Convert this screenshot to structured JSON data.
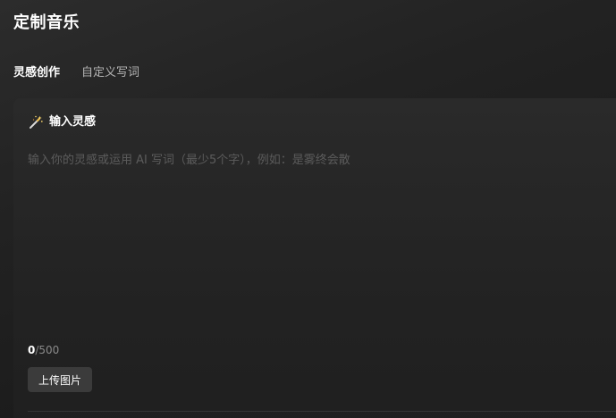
{
  "page": {
    "title": "定制音乐"
  },
  "tabs": [
    {
      "label": "灵感创作",
      "active": true
    },
    {
      "label": "自定义写词",
      "active": false
    }
  ],
  "inspiration_panel": {
    "header_icon": "magic-wand-icon",
    "header_label": "输入灵感",
    "input_value": "",
    "input_placeholder": "输入你的灵感或运用 AI 写词（最少5个字），例如：是雾终会散",
    "char_count": "0",
    "char_separator": "/",
    "char_max": "500",
    "upload_button_label": "上传图片"
  }
}
